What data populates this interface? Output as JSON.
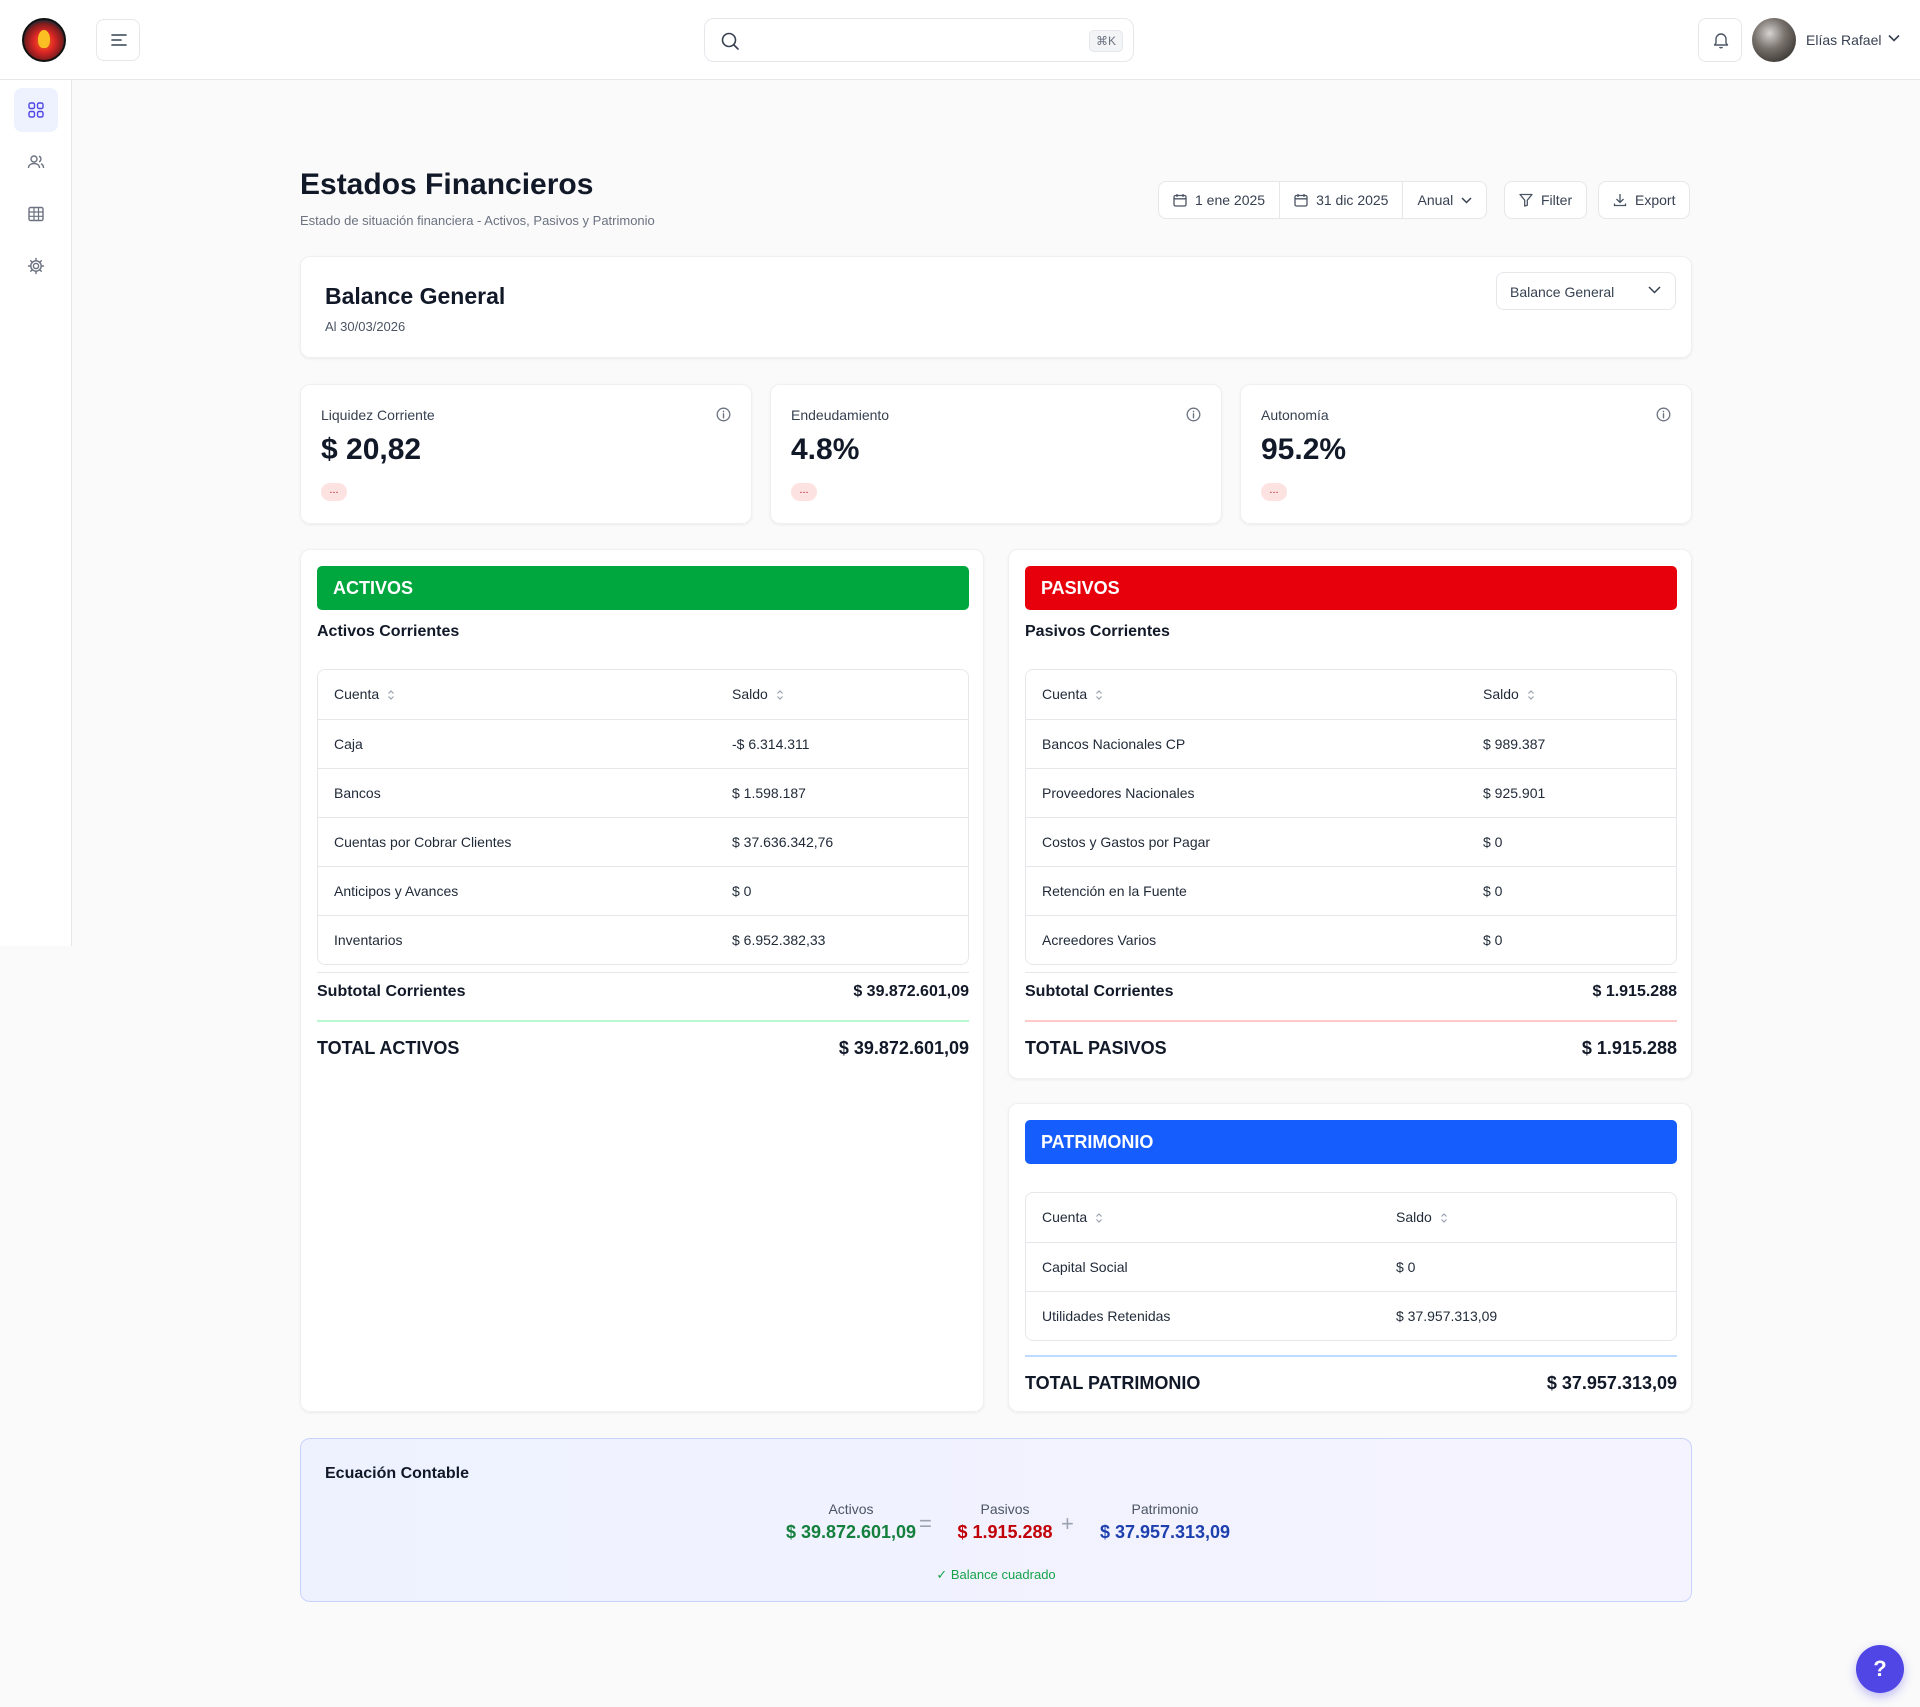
{
  "header": {
    "search_placeholder": "",
    "shortcut": "⌘K",
    "username": "Elías Rafael"
  },
  "sidebar": {
    "items": [
      {
        "icon": "grid-icon",
        "active": true
      },
      {
        "icon": "users-icon",
        "active": false
      },
      {
        "icon": "table-icon",
        "active": false
      },
      {
        "icon": "gear-icon",
        "active": false
      }
    ]
  },
  "page": {
    "title": "Estados Financieros",
    "subtitle": "Estado de situación financiera - Activos, Pasivos y Patrimonio",
    "date_from": "1 ene 2025",
    "date_to": "31 dic 2025",
    "period": "Anual",
    "filter_label": "Filter",
    "export_label": "Export"
  },
  "balance": {
    "title": "Balance General",
    "date": "Al 30/03/2026",
    "report_select": "Balance General"
  },
  "kpis": [
    {
      "label": "Liquidez Corriente",
      "value": "$ 20,82",
      "badge": "..."
    },
    {
      "label": "Endeudamiento",
      "value": "4.8%",
      "badge": "..."
    },
    {
      "label": "Autonomía",
      "value": "95.2%",
      "badge": "..."
    }
  ],
  "activos": {
    "title": "ACTIVOS",
    "subheading": "Activos Corrientes",
    "col_account": "Cuenta",
    "col_balance": "Saldo",
    "rows": [
      {
        "account": "Caja",
        "balance": "-$ 6.314.311"
      },
      {
        "account": "Bancos",
        "balance": "$ 1.598.187"
      },
      {
        "account": "Cuentas por Cobrar Clientes",
        "balance": "$ 37.636.342,76"
      },
      {
        "account": "Anticipos y Avances",
        "balance": "$ 0"
      },
      {
        "account": "Inventarios",
        "balance": "$ 6.952.382,33"
      }
    ],
    "subtotal_label": "Subtotal Corrientes",
    "subtotal_value": "$ 39.872.601,09",
    "total_label": "TOTAL ACTIVOS",
    "total_value": "$ 39.872.601,09"
  },
  "pasivos": {
    "title": "PASIVOS",
    "subheading": "Pasivos Corrientes",
    "col_account": "Cuenta",
    "col_balance": "Saldo",
    "rows": [
      {
        "account": "Bancos Nacionales CP",
        "balance": "$ 989.387"
      },
      {
        "account": "Proveedores Nacionales",
        "balance": "$ 925.901"
      },
      {
        "account": "Costos y Gastos por Pagar",
        "balance": "$ 0"
      },
      {
        "account": "Retención en la Fuente",
        "balance": "$ 0"
      },
      {
        "account": "Acreedores Varios",
        "balance": "$ 0"
      }
    ],
    "subtotal_label": "Subtotal Corrientes",
    "subtotal_value": "$ 1.915.288",
    "total_label": "TOTAL PASIVOS",
    "total_value": "$ 1.915.288"
  },
  "patrimonio": {
    "title": "PATRIMONIO",
    "col_account": "Cuenta",
    "col_balance": "Saldo",
    "rows": [
      {
        "account": "Capital Social",
        "balance": "$ 0"
      },
      {
        "account": "Utilidades Retenidas",
        "balance": "$ 37.957.313,09"
      }
    ],
    "total_label": "TOTAL PATRIMONIO",
    "total_value": "$ 37.957.313,09"
  },
  "equation": {
    "title": "Ecuación Contable",
    "activos_label": "Activos",
    "activos_value": "$ 39.872.601,09",
    "equals": "=",
    "pasivos_label": "Pasivos",
    "pasivos_value": "$ 1.915.288",
    "plus": "+",
    "patrimonio_label": "Patrimonio",
    "patrimonio_value": "$ 37.957.313,09",
    "status": "✓ Balance cuadrado"
  },
  "help": "?",
  "colors": {
    "activos": "#00a63e",
    "pasivos": "#e7000b",
    "patrimonio": "#155dfc",
    "activos_text": "#15803d",
    "pasivos_text": "#c10007",
    "patrimonio_text": "#1e40af"
  }
}
